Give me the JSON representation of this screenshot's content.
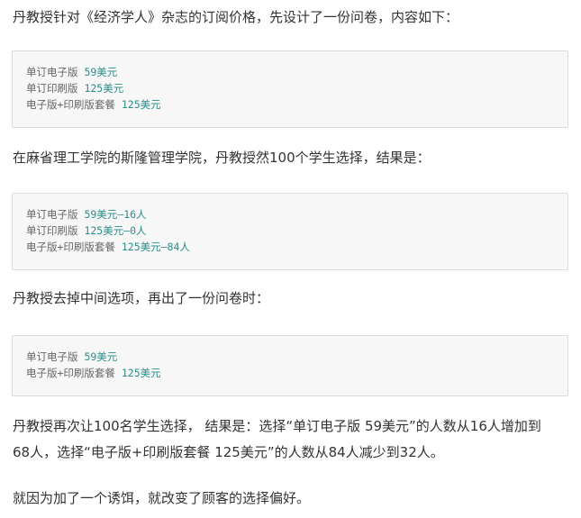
{
  "paragraphs": {
    "p1": "丹教授针对《经济学人》杂志的订阅价格，先设计了一份问卷，内容如下：",
    "p2": "在麻省理工学院的斯隆管理学院，丹教授然100个学生选择，结果是：",
    "p3": "丹教授去掉中间选项，再出了一份问卷时：",
    "p4_line1": "丹教授再次让100名学生选择， 结果是：选择“单订电子版 59美元”的人数从16人增加到",
    "p4_line2": "68人，选择“电子版+印刷版套餐 125美元”的人数从84人减少到32人。",
    "p5": "就因为加了一个诱饵，就改变了顾客的选择偏好。"
  },
  "code_block_1": {
    "line1": {
      "label": "单订电子版 ",
      "value": "59美元"
    },
    "line2": {
      "label": "单订印刷版 ",
      "value": "125美元"
    },
    "line3": {
      "label": "电子版+印刷版套餐 ",
      "value": "125美元"
    }
  },
  "code_block_2": {
    "line1": {
      "label": "单订电子版 ",
      "value": "59美元—16人"
    },
    "line2": {
      "label": "单订印刷版 ",
      "value": "125美元—0人"
    },
    "line3": {
      "label": "电子版+印刷版套餐 ",
      "value": "125美元—84人"
    }
  },
  "code_block_3": {
    "line1": {
      "label": "单订电子版 ",
      "value": "59美元"
    },
    "line2": {
      "label": "电子版+印刷版套餐 ",
      "value": "125美元"
    }
  },
  "colors": {
    "text": "#333333",
    "code_text": "#666666",
    "code_number": "#2a8f8a",
    "code_background": "#f7f7f7",
    "code_border": "#dcdcdc"
  }
}
